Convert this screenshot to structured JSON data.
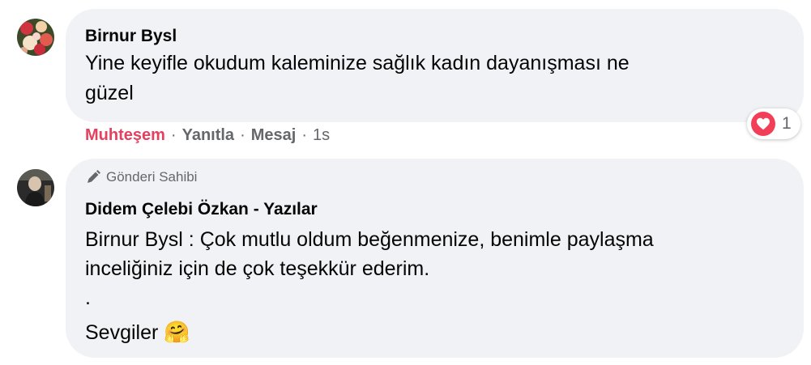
{
  "comment1": {
    "author": "Birnur Bysl",
    "lines": [
      "Yine keyifle okudum kaleminize sağlık kadın dayanışması ne",
      "güzel"
    ],
    "actions": {
      "reaction": "Muhteşem",
      "reply": "Yanıtla",
      "message": "Mesaj",
      "separator": "·",
      "time": "1s"
    },
    "reactions": {
      "icon": "heart-icon",
      "count": "1",
      "color": "#f33e58"
    }
  },
  "reply1": {
    "badge": "Gönderi Sahibi",
    "author": "Didem Çelebi Özkan - Yazılar",
    "lines": [
      "Birnur Bysl : Çok mutlu oldum beğenmenize, benimle paylaşma",
      "inceliğiniz için de çok teşekkür ederim.",
      ".",
      "Sevgiler"
    ],
    "emoji": "🤗"
  },
  "colors": {
    "bubble": "#f0f2f5",
    "reaction_text": "#e4405f",
    "meta_text": "#65676b"
  }
}
